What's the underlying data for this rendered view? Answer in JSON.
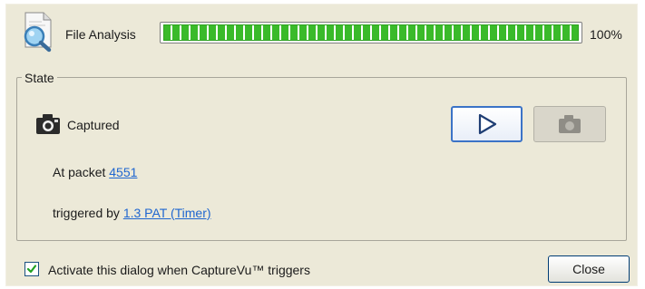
{
  "header": {
    "icon": "document-magnifier-icon",
    "label": "File Analysis",
    "progress_fraction": 1.0,
    "progress_text": "100%",
    "progress_color": "#3aba2a"
  },
  "state": {
    "legend": "State",
    "status_icon": "camera-icon",
    "status": "Captured",
    "play_button_icon": "play-icon",
    "snapshot_button_icon": "camera-icon",
    "packet_prefix": "At packet ",
    "packet_link": "4551",
    "trigger_prefix": "triggered by ",
    "trigger_link": "1.3 PAT (Timer)"
  },
  "footer": {
    "activate_checked": true,
    "activate_label": "Activate this dialog when CaptureVu™ triggers",
    "close_label": "Close"
  },
  "colors": {
    "dialog_bg": "#ece9d8",
    "link": "#1f66d0",
    "accent_border": "#3b73c7"
  }
}
